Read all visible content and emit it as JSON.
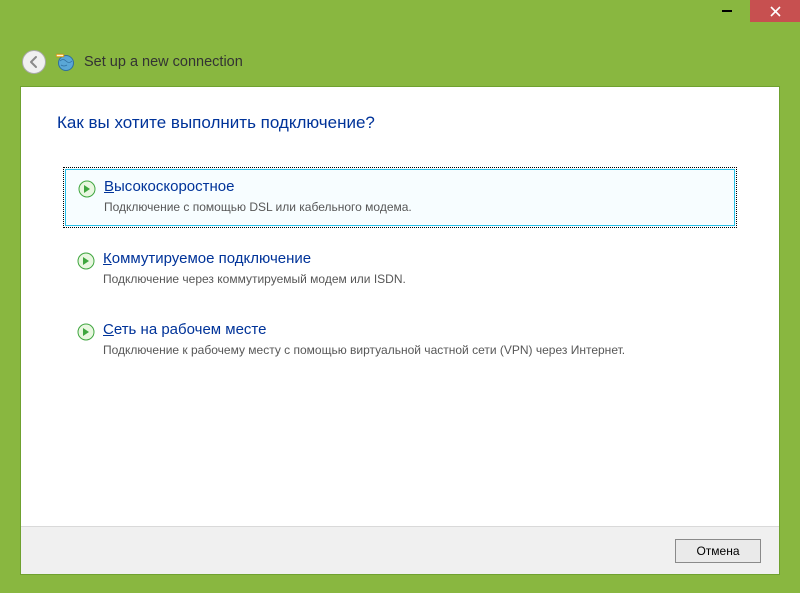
{
  "window": {
    "title": "Set up a new connection"
  },
  "main": {
    "heading": "Как вы хотите выполнить подключение?",
    "options": [
      {
        "accel": "В",
        "title_rest": "ысокоскоростное",
        "desc": "Подключение с помощью DSL или кабельного модема.",
        "selected": true
      },
      {
        "accel": "К",
        "title_rest": "оммутируемое подключение",
        "desc": "Подключение через коммутируемый модем или ISDN.",
        "selected": false
      },
      {
        "accel": "С",
        "title_rest": "еть на рабочем месте",
        "desc": "Подключение к рабочему месту с помощью виртуальной частной сети (VPN) через Интернет.",
        "selected": false
      }
    ]
  },
  "buttons": {
    "cancel": "Отмена"
  }
}
